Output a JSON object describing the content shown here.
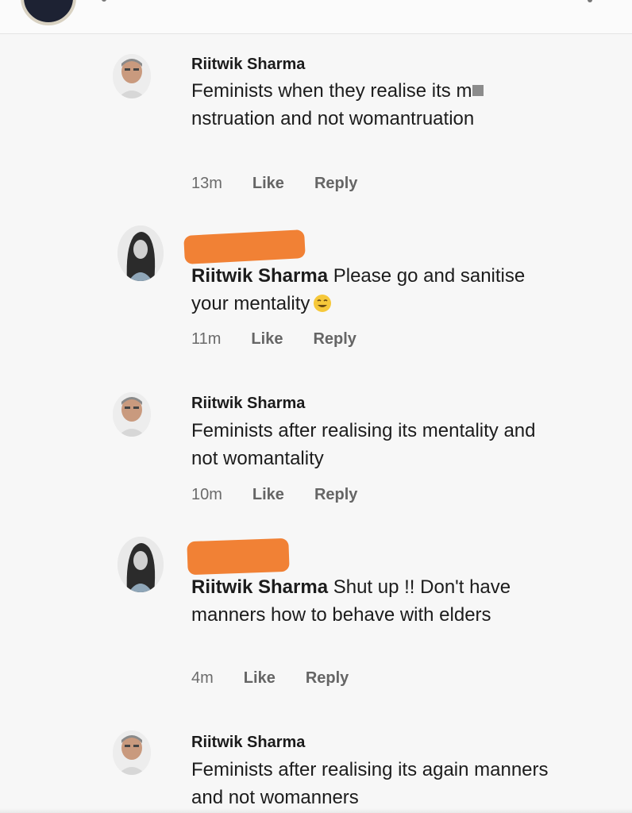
{
  "comments": [
    {
      "author": "Riitwik Sharma",
      "text_before_mask": "Feminists when they realise its m",
      "text_after_mask": "nstruation and not womantruation",
      "time": "13m",
      "like": "Like",
      "reply": "Reply"
    },
    {
      "mention": "Riitwik Sharma",
      "text": " Please go and sanitise your mentality",
      "emoji": "smiling-face-emoji",
      "time": "11m",
      "like": "Like",
      "reply": "Reply"
    },
    {
      "author": "Riitwik Sharma",
      "text": "Feminists after realising its mentality and not womantality",
      "time": "10m",
      "like": "Like",
      "reply": "Reply"
    },
    {
      "mention": "Riitwik Sharma",
      "text": " Shut up !! Don't have manners how to behave with elders",
      "time": "4m",
      "like": "Like",
      "reply": "Reply"
    },
    {
      "author": "Riitwik Sharma",
      "text": "Feminists after realising its again manners and not womanners"
    }
  ],
  "colors": {
    "redaction": "#f07a2a",
    "meta_text": "#6b6b6b"
  }
}
